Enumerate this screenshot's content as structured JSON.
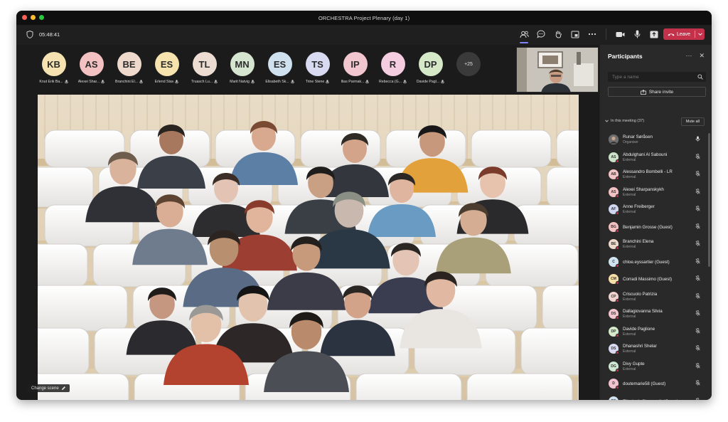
{
  "window": {
    "title": "ORCHESTRA Project Plenary (day 1)"
  },
  "toolbar": {
    "timer": "05:48:41",
    "leave_label": "Leave"
  },
  "gallery": {
    "avatars": [
      {
        "initials": "KB",
        "name": "Knut Erik Ba...",
        "color": "#f6e2b0"
      },
      {
        "initials": "AS",
        "name": "Alexei Shar...",
        "color": "#f3c1c1"
      },
      {
        "initials": "BE",
        "name": "Branchini El...",
        "color": "#efd9cc"
      },
      {
        "initials": "ES",
        "name": "Erlend Stav",
        "color": "#f7e3ad"
      },
      {
        "initials": "TL",
        "name": "Truasch Lu...",
        "color": "#ecdcd2"
      },
      {
        "initials": "MN",
        "name": "Marit Natvig",
        "color": "#d5e5cf"
      },
      {
        "initials": "ES",
        "name": "Elisabeth Sk...",
        "color": "#cfe1ee"
      },
      {
        "initials": "TS",
        "name": "Trine Stene",
        "color": "#d8daf2"
      },
      {
        "initials": "IP",
        "name": "Ilias Parmak...",
        "color": "#f2c6cf"
      },
      {
        "initials": "R",
        "name": "Rebecca (G...",
        "color": "#f5cde0"
      },
      {
        "initials": "DP",
        "name": "Davide Pagl...",
        "color": "#d5e8c8"
      }
    ],
    "more_count": "+25",
    "change_scene": "Change scene"
  },
  "panel": {
    "title": "Participants",
    "search_placeholder": "Type a name",
    "share_invite": "Share invite",
    "in_meeting": "In this meeting (37)",
    "mute_all": "Mute all",
    "participants": [
      {
        "initials": "RS",
        "name": "Runar Søråsen",
        "role": "Organiser",
        "color": "#8a8a8a",
        "photo": true,
        "muted": false
      },
      {
        "initials": "AS",
        "name": "Abdulghani Al Sabouni",
        "role": "External",
        "color": "#cde3c9",
        "muted": true
      },
      {
        "initials": "AB",
        "name": "Alessandro Bombelli - LR",
        "role": "External",
        "color": "#f2c4c4",
        "muted": true
      },
      {
        "initials": "AS",
        "name": "Alexei Sharpanskykh",
        "role": "External",
        "color": "#f3c1c1",
        "muted": true
      },
      {
        "initials": "AF",
        "name": "Anne Freiberger",
        "role": "External",
        "color": "#cfd6f0",
        "muted": true
      },
      {
        "initials": "BG",
        "name": "Benjamin Grosse (Guest)",
        "role": "",
        "color": "#f2c2c2",
        "muted": true
      },
      {
        "initials": "BE",
        "name": "Branchini Elena",
        "role": "External",
        "color": "#efd9cc",
        "muted": true
      },
      {
        "initials": "C",
        "name": "chloe.eyssartier (Guest)",
        "role": "",
        "color": "#cfe4f0",
        "muted": true
      },
      {
        "initials": "CM",
        "name": "Corradi Massimo (Guest)",
        "role": "",
        "color": "#f7e0a8",
        "muted": true
      },
      {
        "initials": "CP",
        "name": "Criscuolo Patrizia",
        "role": "External",
        "color": "#f0d3cc",
        "muted": true
      },
      {
        "initials": "DS",
        "name": "Dallagiovanna Silvia",
        "role": "External",
        "color": "#f2c6cf",
        "muted": true
      },
      {
        "initials": "DP",
        "name": "Davide Paglione",
        "role": "External",
        "color": "#d5e8c8",
        "muted": true
      },
      {
        "initials": "DS",
        "name": "Dhanashri Shelar",
        "role": "External",
        "color": "#d8daf2",
        "muted": true
      },
      {
        "initials": "DG",
        "name": "Divy Gupte",
        "role": "External",
        "color": "#cfe6d2",
        "muted": true
      },
      {
        "initials": "D",
        "name": "doutemarie58 (Guest)",
        "role": "",
        "color": "#f2c4cf",
        "muted": true
      },
      {
        "initials": "ES",
        "name": "Elisabeth Skuggevik (Guest)",
        "role": "",
        "color": "#cfe1ee",
        "muted": true
      }
    ]
  }
}
